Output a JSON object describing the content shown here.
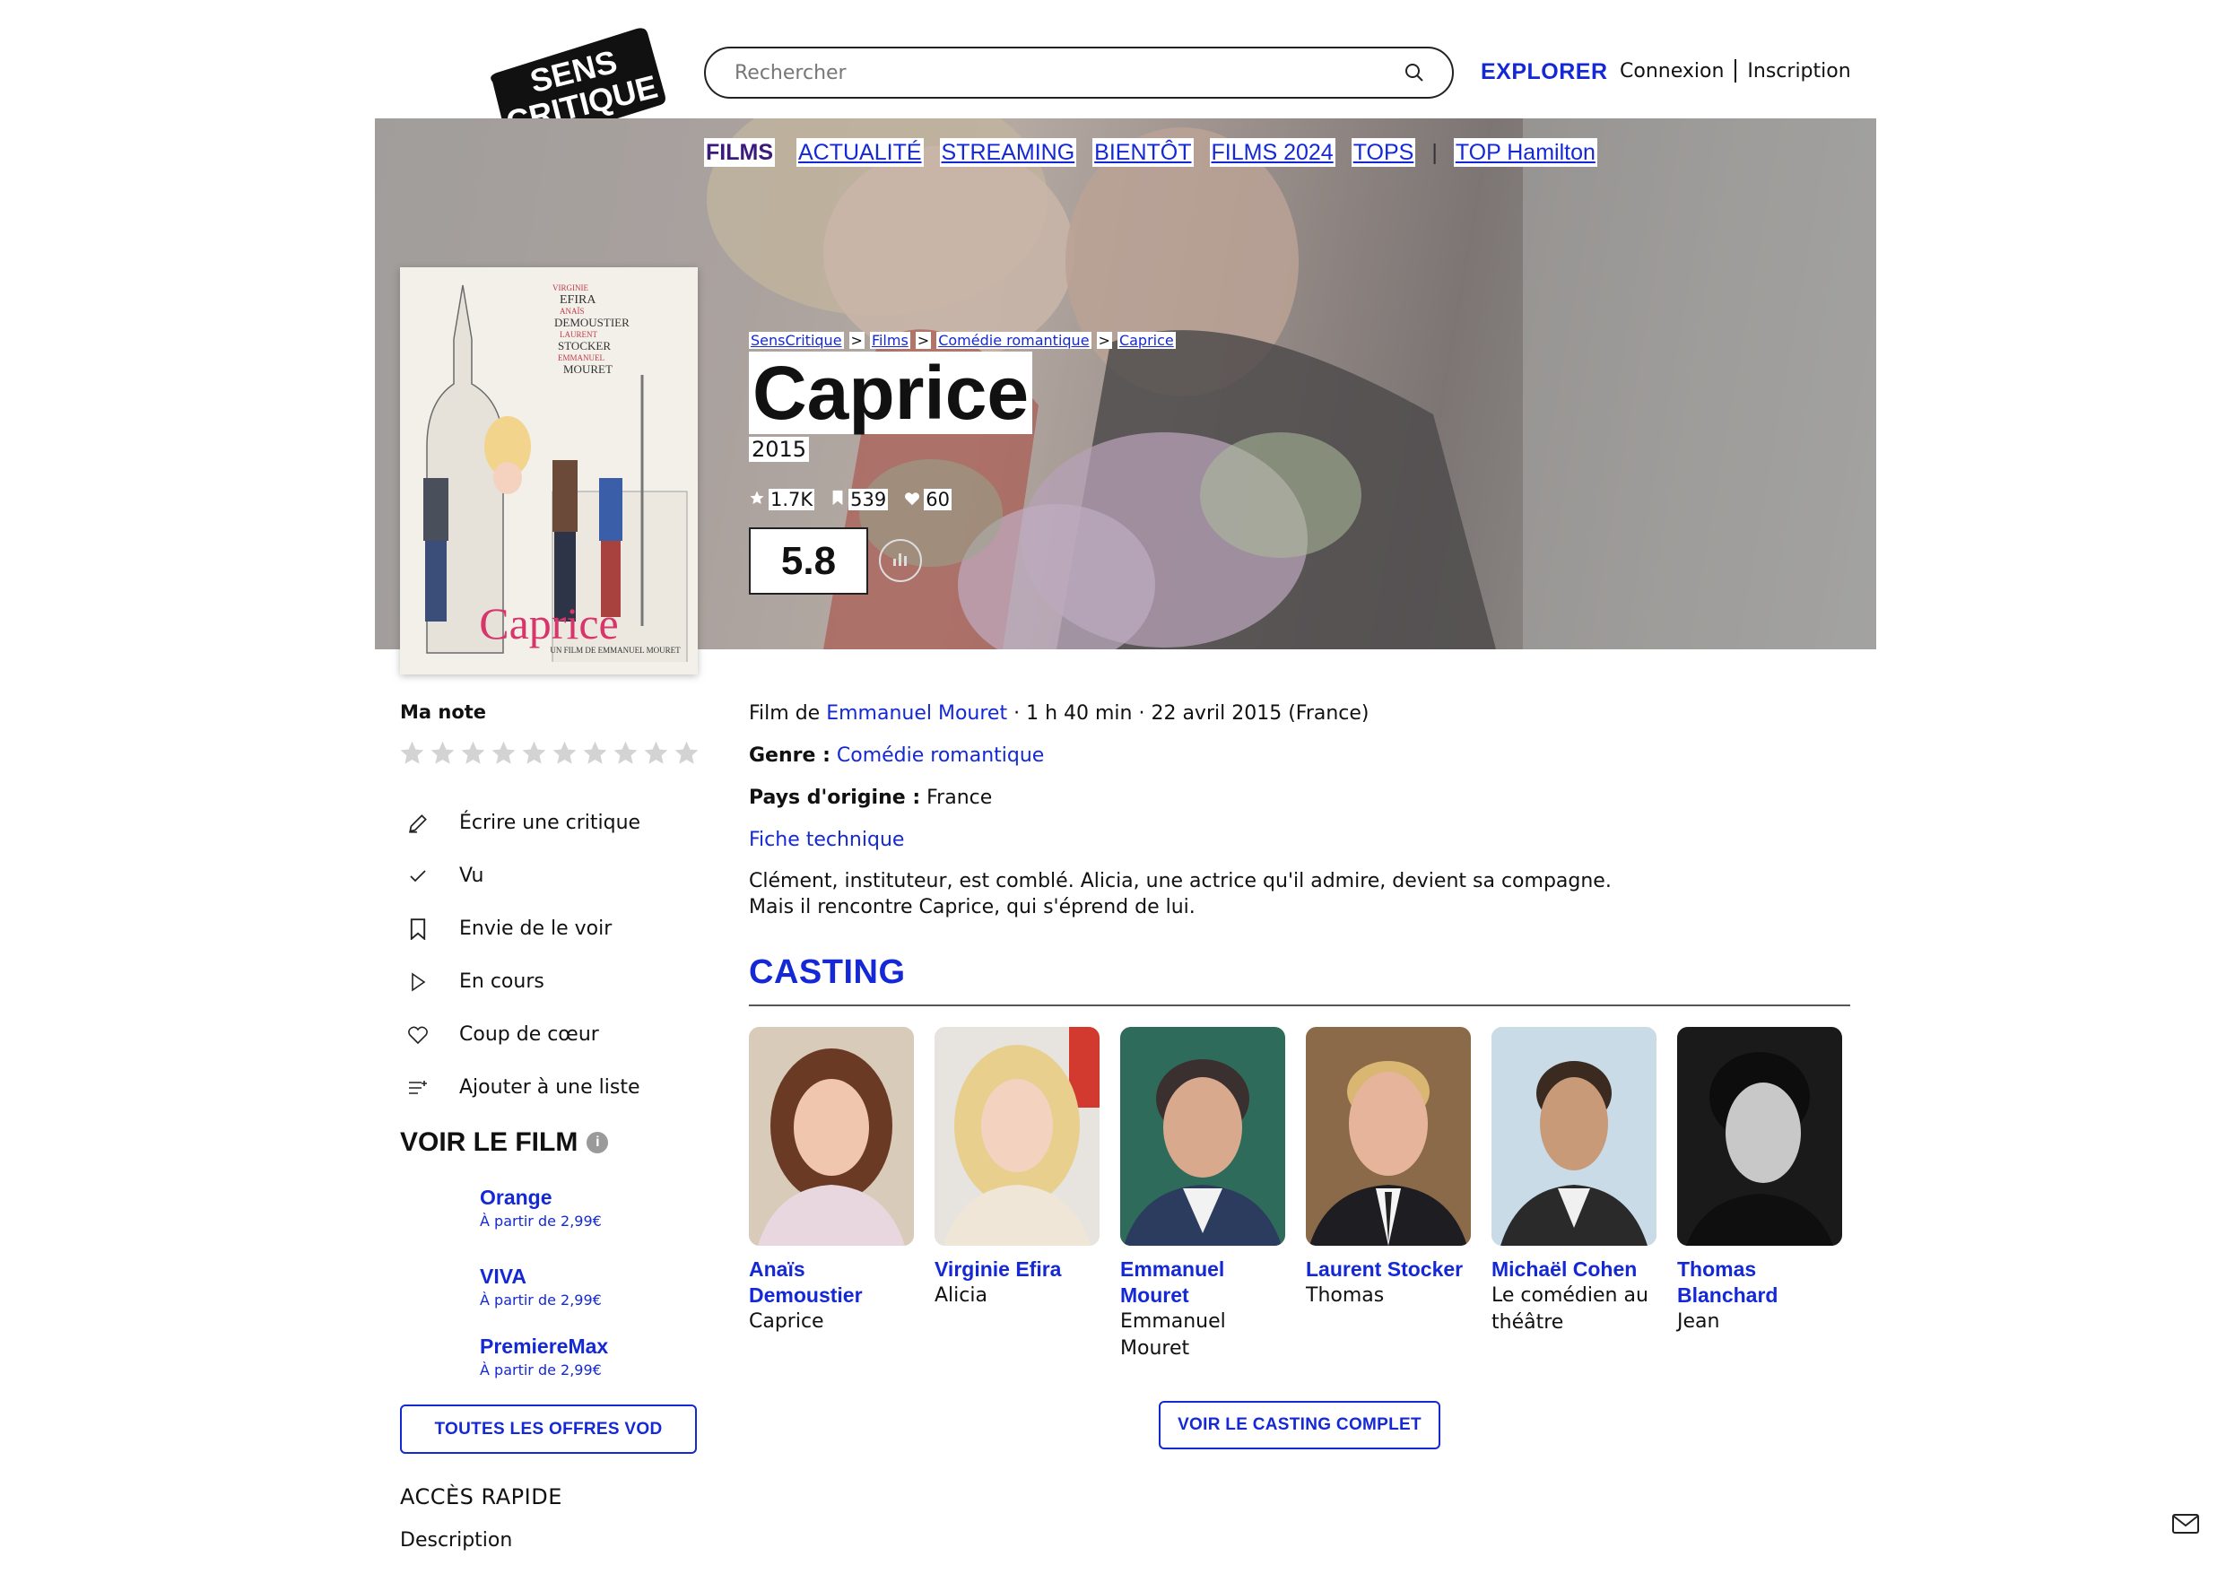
{
  "brand": {
    "logo_line1": "SENS",
    "logo_line2": "CRITIQUE"
  },
  "search": {
    "placeholder": "Rechercher"
  },
  "header": {
    "explorer": "EXPLORER",
    "login": "Connexion",
    "signup": "Inscription"
  },
  "nav": {
    "items": [
      "FILMS",
      "ACTUALITÉ",
      "STREAMING",
      "BIENTÔT",
      "FILMS 2024",
      "TOPS",
      "TOP Hamilton"
    ],
    "separator": "|"
  },
  "breadcrumb": {
    "items": [
      "SensCritique",
      "Films",
      "Comédie romantique",
      "Caprice"
    ],
    "separator": ">"
  },
  "movie": {
    "title": "Caprice",
    "year": "2015",
    "ratings_count": "1.7K",
    "wishlist_count": "539",
    "favorites_count": "60",
    "score": "5.8",
    "director_prefix": "Film de",
    "director": "Emmanuel Mouret",
    "duration_release": "· 1 h 40 min · 22 avril 2015 (France)",
    "genre_label": "Genre :",
    "genre": "Comédie romantique",
    "country_label": "Pays d'origine :",
    "country": "France",
    "tech_sheet": "Fiche technique",
    "synopsis_line1": "Clément, instituteur, est comblé. Alicia, une actrice qu'il admire, devient sa compagne.",
    "synopsis_line2": "Mais il rencontre Caprice, qui s'éprend de lui."
  },
  "poster": {
    "names": [
      "VIRGINIE",
      "EFIRA",
      "ANAÏS",
      "DEMOUSTIER",
      "LAURENT",
      "STOCKER",
      "EMMANUEL",
      "MOURET"
    ],
    "title": "Caprice",
    "subtitle": "UN FILM DE EMMANUEL MOURET"
  },
  "sidebar": {
    "my_rating": "Ma note",
    "star_count": 10,
    "actions": [
      {
        "label": "Écrire une critique",
        "icon": "pencil-icon"
      },
      {
        "label": "Vu",
        "icon": "check-icon"
      },
      {
        "label": "Envie de le voir",
        "icon": "bookmark-icon"
      },
      {
        "label": "En cours",
        "icon": "play-icon"
      },
      {
        "label": "Coup de cœur",
        "icon": "heart-icon"
      },
      {
        "label": "Ajouter à une liste",
        "icon": "list-add-icon"
      }
    ],
    "watch_title": "VOIR LE FILM",
    "offers": [
      {
        "name": "Orange",
        "price": "À partir de 2,99€"
      },
      {
        "name": "VIVA",
        "price": "À partir de 2,99€"
      },
      {
        "name": "PremiereMax",
        "price": "À partir de 2,99€"
      }
    ],
    "vod_button": "TOUTES LES OFFRES VOD",
    "quick_access": "ACCÈS RAPIDE",
    "quick_links": [
      "Description"
    ]
  },
  "casting": {
    "title": "CASTING",
    "members": [
      {
        "actor_line1": "Anaïs",
        "actor_line2": "Demoustier",
        "role_line1": "Caprice",
        "role_line2": ""
      },
      {
        "actor_line1": "Virginie Efira",
        "actor_line2": "",
        "role_line1": "Alicia",
        "role_line2": ""
      },
      {
        "actor_line1": "Emmanuel",
        "actor_line2": "Mouret",
        "role_line1": "Emmanuel",
        "role_line2": "Mouret"
      },
      {
        "actor_line1": "Laurent Stocker",
        "actor_line2": "",
        "role_line1": "Thomas",
        "role_line2": ""
      },
      {
        "actor_line1": "Michaël Cohen",
        "actor_line2": "",
        "role_line1": "Le comédien au",
        "role_line2": "théâtre"
      },
      {
        "actor_line1": "Thomas",
        "actor_line2": "Blanchard",
        "role_line1": "Jean",
        "role_line2": ""
      }
    ],
    "full_button": "VOIR LE CASTING COMPLET"
  },
  "colors": {
    "accent": "#1428d6",
    "nav_active": "#3a1a7a",
    "text": "#111111"
  }
}
